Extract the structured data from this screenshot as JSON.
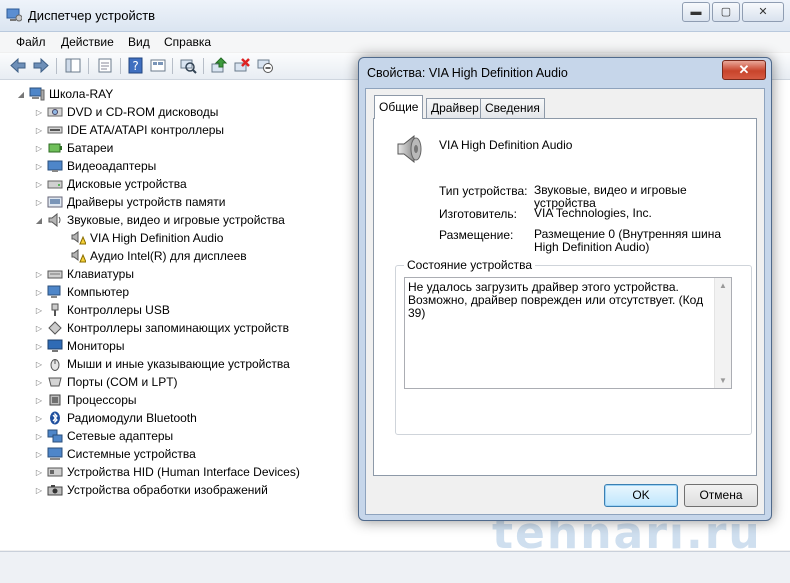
{
  "window": {
    "title": "Диспетчер устройств",
    "caption": {
      "minimize": "▬",
      "maximize": "▢",
      "close": "✕"
    }
  },
  "menu": [
    "Файл",
    "Действие",
    "Вид",
    "Справка"
  ],
  "tree": {
    "root": "Школа-RAY",
    "items": [
      "DVD и CD-ROM дисководы",
      "IDE ATA/ATAPI контроллеры",
      "Батареи",
      "Видеоадаптеры",
      "Дисковые устройства",
      "Драйверы устройств памяти",
      "Звуковые, видео и игровые устройства",
      "VIA High Definition Audio",
      "Аудио Intel(R) для дисплеев",
      "Клавиатуры",
      "Компьютер",
      "Контроллеры USB",
      "Контроллеры запоминающих устройств",
      "Мониторы",
      "Мыши и иные указывающие устройства",
      "Порты (COM и LPT)",
      "Процессоры",
      "Радиомодули Bluetooth",
      "Сетевые адаптеры",
      "Системные устройства",
      "Устройства HID (Human Interface Devices)",
      "Устройства обработки изображений"
    ]
  },
  "dialog": {
    "title": "Свойства: VIA High Definition Audio",
    "close": "✕",
    "tabs": [
      "Общие",
      "Драйвер",
      "Сведения"
    ],
    "device_name": "VIA High Definition Audio",
    "props": {
      "type_label": "Тип устройства:",
      "type_value": "Звуковые, видео и игровые устройства",
      "maker_label": "Изготовитель:",
      "maker_value": "VIA Technologies, Inc.",
      "location_label": "Размещение:",
      "location_value": "Размещение 0 (Внутренняя шина High Definition Audio)"
    },
    "status_group": "Состояние устройства",
    "status_text": "Не удалось загрузить драйвер этого устройства. Возможно, драйвер поврежден или отсутствует. (Код 39)",
    "ok": "OK",
    "cancel": "Отмена"
  },
  "watermark": "tehnari.ru"
}
